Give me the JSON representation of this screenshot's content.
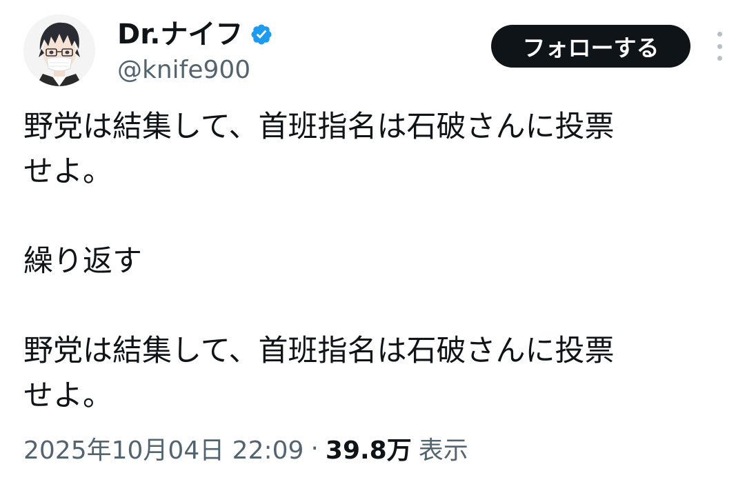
{
  "author": {
    "display_name": "Dr.ナイフ",
    "handle": "@knife900",
    "verified": true
  },
  "follow_button_label": "フォローする",
  "tweet": {
    "lines": [
      "野党は結集して、首班指名は石破さんに投票",
      "せよ。",
      "",
      "繰り返す",
      "",
      "野党は結集して、首班指名は石破さんに投票",
      "せよ。"
    ]
  },
  "meta": {
    "timestamp": "2025年10月04日 22:09",
    "separator": "·",
    "views_count": "39.8万",
    "views_label": "表示"
  },
  "colors": {
    "text_primary": "#0f1419",
    "text_secondary": "#536471",
    "verified_badge": "#1d9bf0",
    "follow_button_bg": "#0f1419"
  },
  "icons": {
    "verified": "verified-badge-icon",
    "more": "more-options-icon"
  }
}
